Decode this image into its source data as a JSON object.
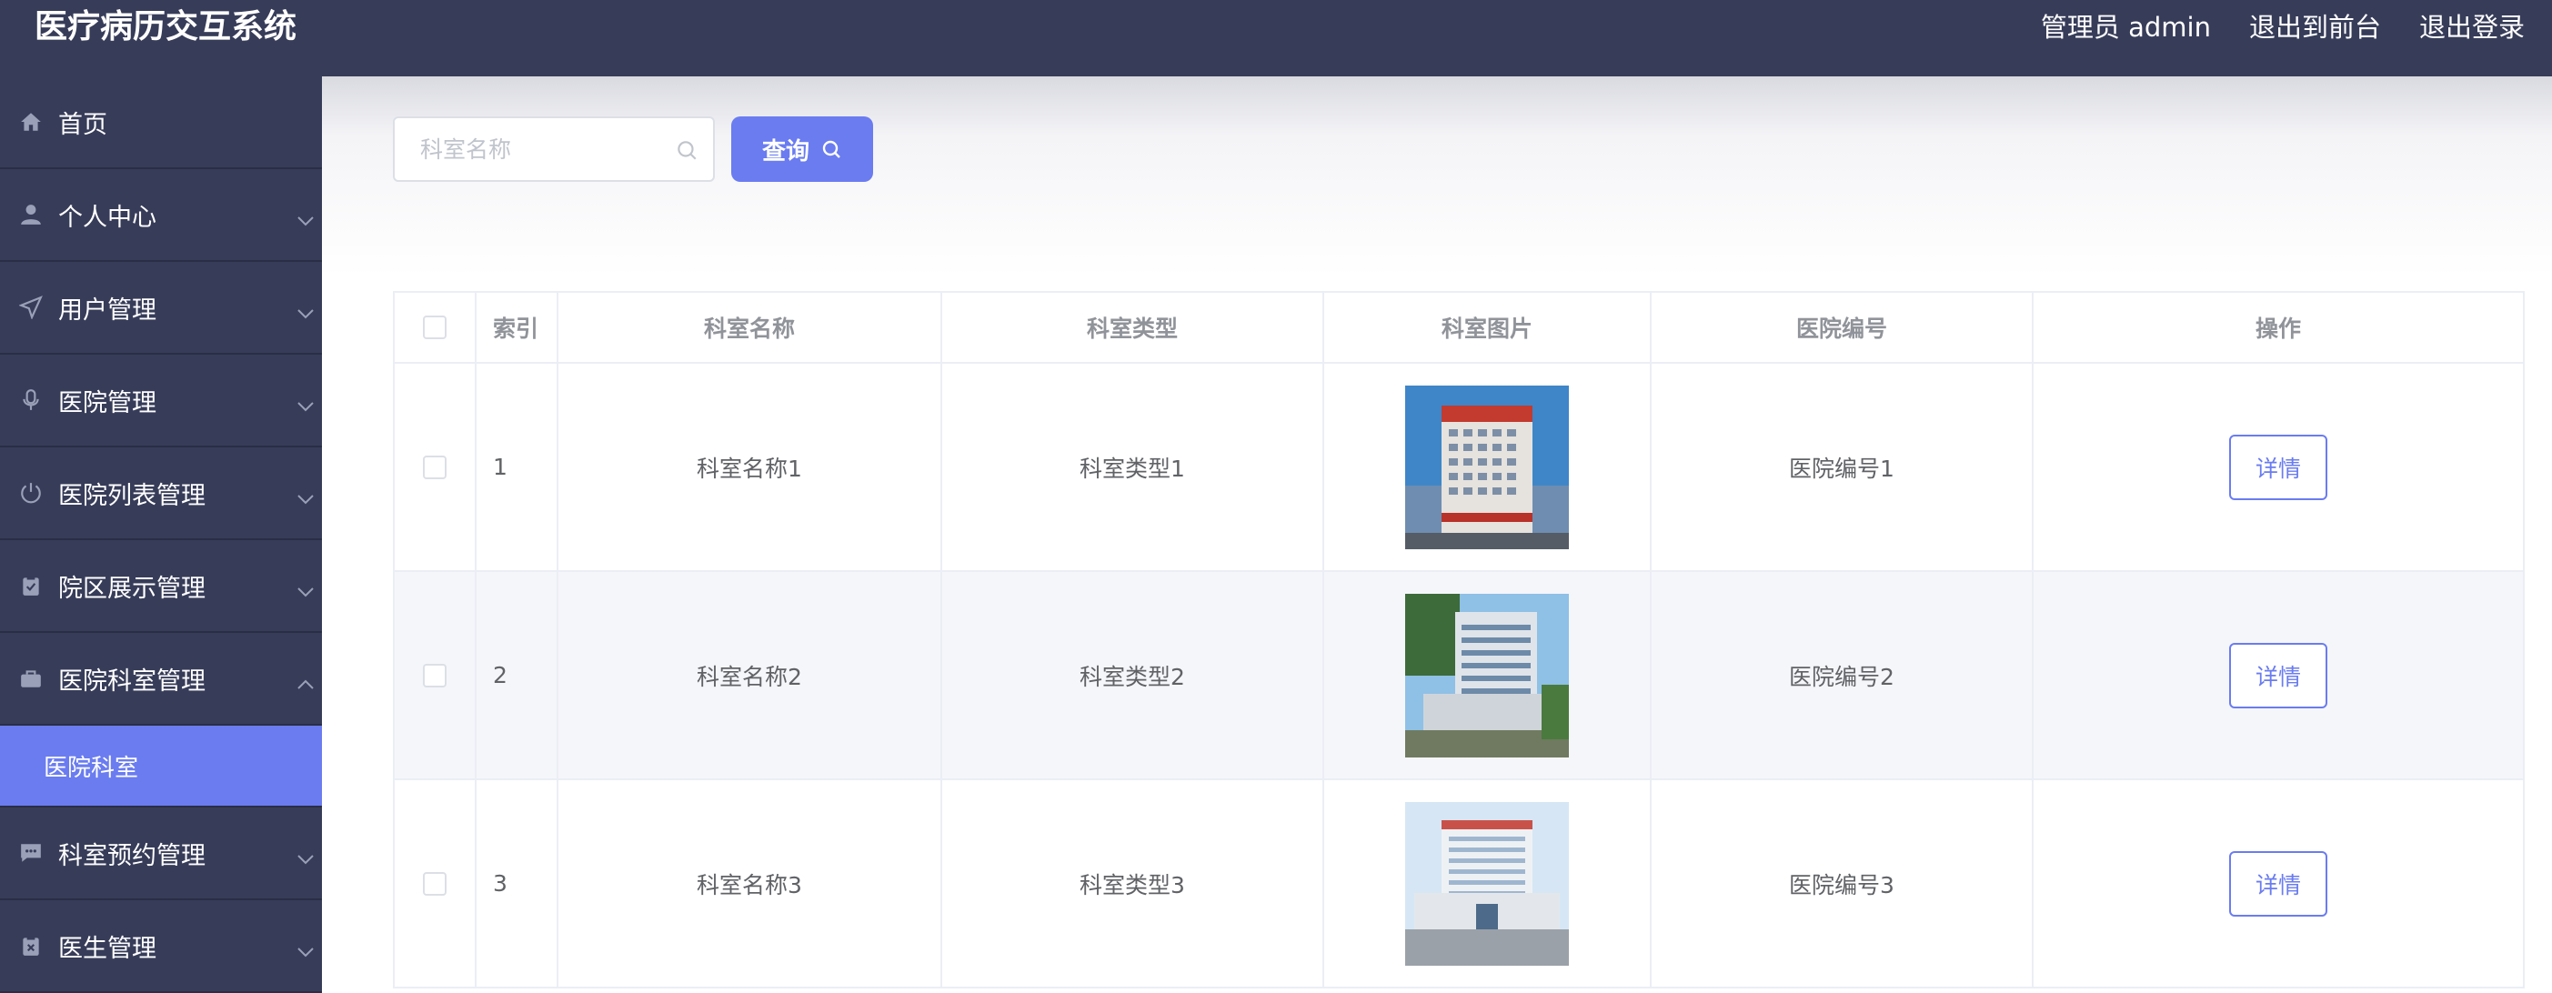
{
  "header": {
    "title": "医疗病历交互系统",
    "user_label": "管理员 admin",
    "front_link": "退出到前台",
    "logout_link": "退出登录"
  },
  "sidebar": {
    "items": [
      {
        "label": "首页",
        "icon": "home-icon"
      },
      {
        "label": "个人中心",
        "icon": "user-icon"
      },
      {
        "label": "用户管理",
        "icon": "send-icon"
      },
      {
        "label": "医院管理",
        "icon": "microphone-icon"
      },
      {
        "label": "医院列表管理",
        "icon": "power-icon"
      },
      {
        "label": "院区展示管理",
        "icon": "clipboard-icon"
      },
      {
        "label": "医院科室管理",
        "icon": "suitcase-icon"
      },
      {
        "label": "科室预约管理",
        "icon": "chat-icon"
      },
      {
        "label": "医生管理",
        "icon": "clipboard-x-icon"
      }
    ],
    "active_sub": "医院科室"
  },
  "search": {
    "placeholder": "科室名称",
    "button_label": "查询"
  },
  "table": {
    "columns": [
      "索引",
      "科室名称",
      "科室类型",
      "科室图片",
      "医院编号",
      "操作"
    ],
    "rows": [
      {
        "index": "1",
        "name": "科室名称1",
        "type": "科室类型1",
        "hospital": "医院编号1",
        "action": "详情"
      },
      {
        "index": "2",
        "name": "科室名称2",
        "type": "科室类型2",
        "hospital": "医院编号2",
        "action": "详情"
      },
      {
        "index": "3",
        "name": "科室名称3",
        "type": "科室类型3",
        "hospital": "医院编号3",
        "action": "详情"
      }
    ]
  },
  "colors": {
    "nav_bg": "#373c59",
    "accent": "#6a7cf0"
  }
}
